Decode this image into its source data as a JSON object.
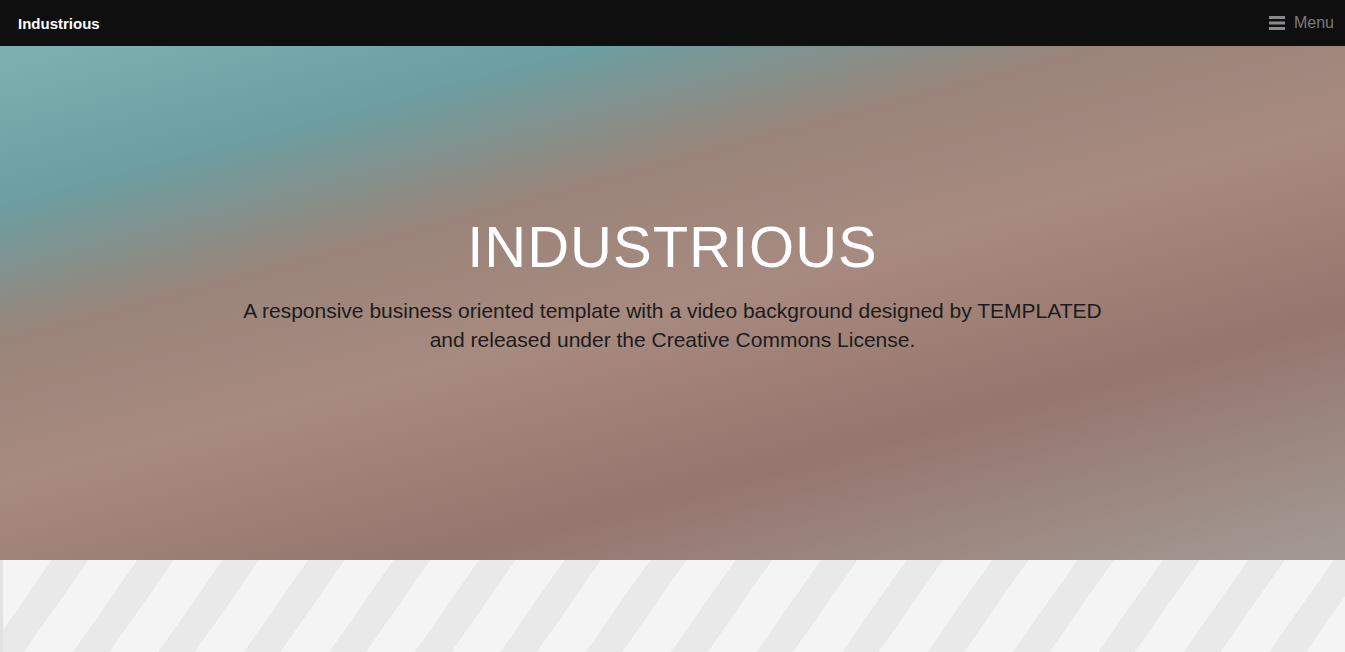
{
  "navbar": {
    "logo": "Industrious",
    "menu_label": "Menu"
  },
  "hero": {
    "title": "INDUSTRIOUS",
    "subtitle": "A responsive business oriented template with a video background designed by TEMPLATED and released under the Creative Commons License."
  }
}
